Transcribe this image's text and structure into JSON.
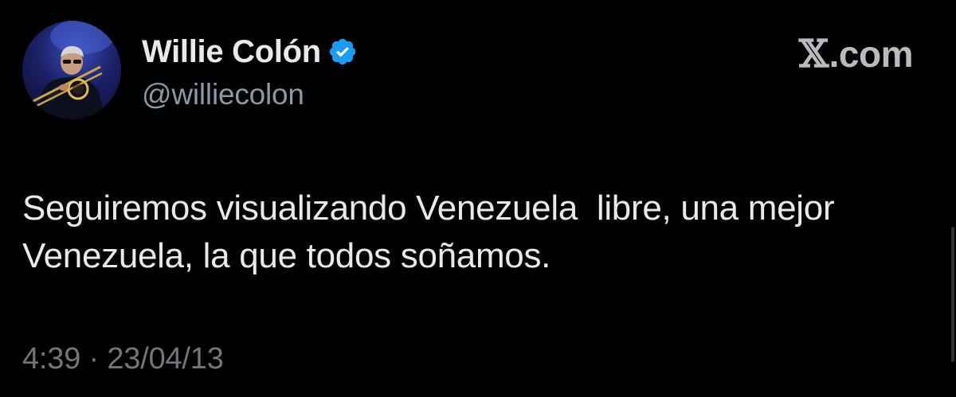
{
  "author": {
    "display_name": "Willie Colón",
    "handle": "@williecolon",
    "verified": true
  },
  "brand": {
    "x_glyph": "𝕏",
    "suffix": ".com"
  },
  "tweet": {
    "text": "Seguiremos visualizando Venezuela  libre, una mejor Venezuela, la que todos soñamos.",
    "time": "4:39",
    "separator": " · ",
    "date": "23/04/13"
  },
  "colors": {
    "background": "#000000",
    "primary_text": "#e7e9ea",
    "secondary_text": "#8b98a5",
    "verified_blue": "#1d9bf0"
  }
}
